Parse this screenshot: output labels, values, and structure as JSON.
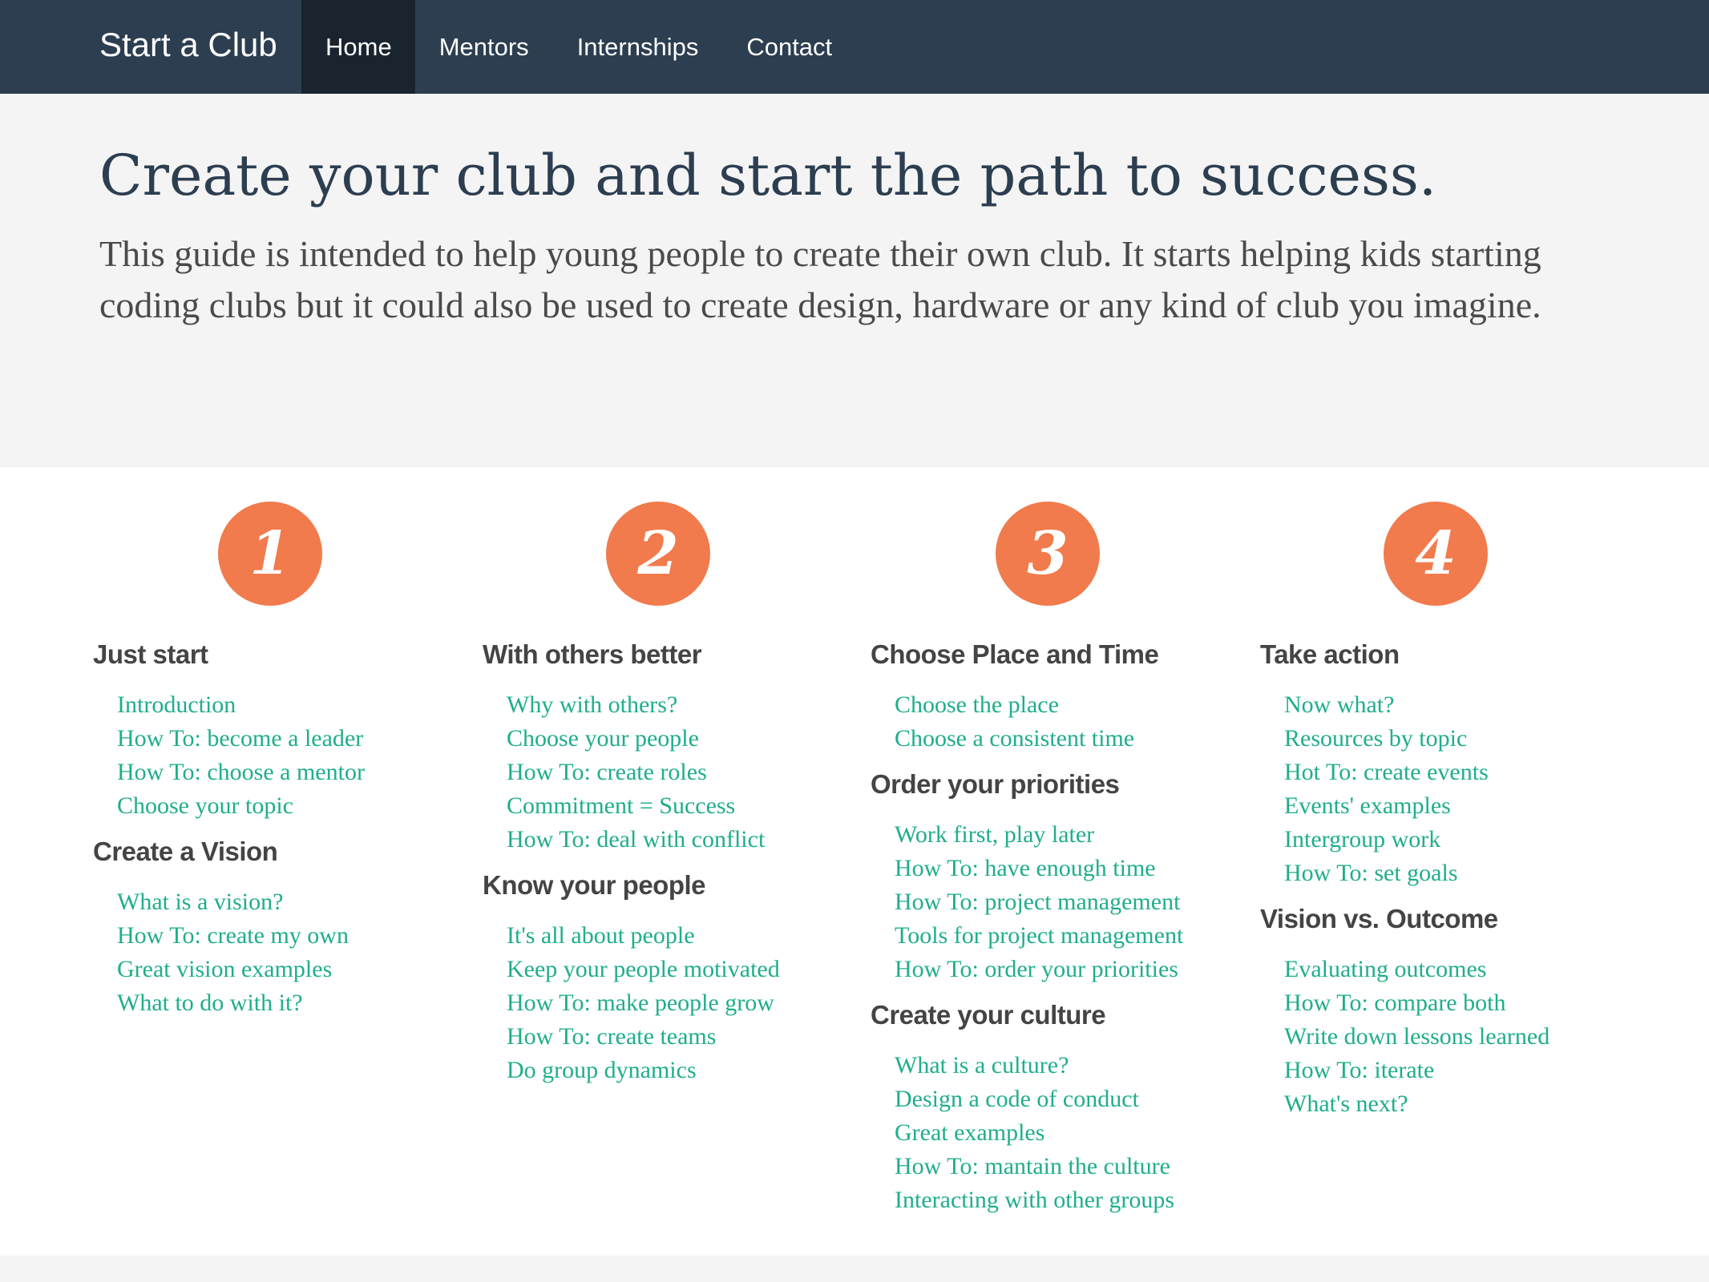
{
  "navbar": {
    "brand": "Start a Club",
    "items": [
      {
        "label": "Home",
        "active": true
      },
      {
        "label": "Mentors",
        "active": false
      },
      {
        "label": "Internships",
        "active": false
      },
      {
        "label": "Contact",
        "active": false
      }
    ]
  },
  "hero": {
    "title": "Create your club and start the path to success.",
    "text": "This guide is intended to help young people to create their own club. It starts helping kids starting coding clubs but it could also be used to create design, hardware or any kind of club you imagine."
  },
  "colors": {
    "navbar_bg": "#2c3e50",
    "navbar_active_bg": "#1a242f",
    "hero_bg": "#f4f4f4",
    "title_color": "#2c3e50",
    "accent_orange": "#f17b4c",
    "link_teal": "#1fae8b",
    "section_title": "#444444"
  },
  "steps": [
    {
      "number": "1",
      "sections": [
        {
          "title": "Just start",
          "links": [
            "Introduction",
            "How To: become a leader",
            "How To: choose a mentor",
            "Choose your topic"
          ]
        },
        {
          "title": "Create a Vision",
          "links": [
            "What is a vision?",
            "How To: create my own",
            "Great vision examples",
            "What to do with it?"
          ]
        }
      ]
    },
    {
      "number": "2",
      "sections": [
        {
          "title": "With others better",
          "links": [
            "Why with others?",
            "Choose your people",
            "How To: create roles",
            "Commitment = Success",
            "How To: deal with conflict"
          ]
        },
        {
          "title": "Know your people",
          "links": [
            "It's all about people",
            "Keep your people motivated",
            "How To: make people grow",
            "How To: create teams",
            "Do group dynamics"
          ]
        }
      ]
    },
    {
      "number": "3",
      "sections": [
        {
          "title": "Choose Place and Time",
          "links": [
            "Choose the place",
            "Choose a consistent time"
          ]
        },
        {
          "title": "Order your priorities",
          "links": [
            "Work first, play later",
            "How To: have enough time",
            "How To: project management",
            "Tools for project management",
            "How To: order your priorities"
          ]
        },
        {
          "title": "Create your culture",
          "links": [
            "What is a culture?",
            "Design a code of conduct",
            "Great examples",
            "How To: mantain the culture",
            "Interacting with other groups"
          ]
        }
      ]
    },
    {
      "number": "4",
      "sections": [
        {
          "title": "Take action",
          "links": [
            "Now what?",
            "Resources by topic",
            "Hot To: create events",
            "Events' examples",
            "Intergroup work",
            "How To: set goals"
          ]
        },
        {
          "title": "Vision vs. Outcome",
          "links": [
            "Evaluating outcomes",
            "How To: compare both",
            "Write down lessons learned",
            "How To: iterate",
            "What's next?"
          ]
        }
      ]
    }
  ]
}
